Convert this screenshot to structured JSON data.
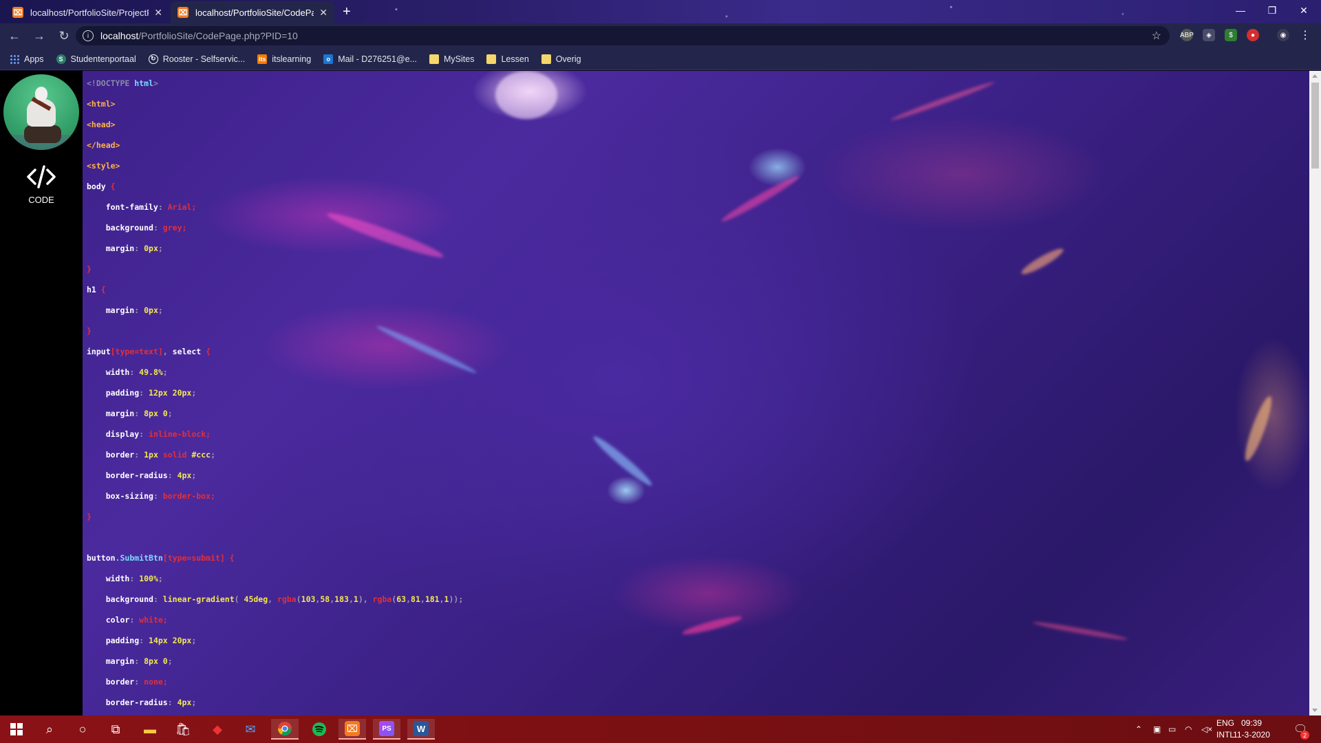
{
  "browser": {
    "tabs": [
      {
        "title": "localhost/PortfolioSite/ProjectPa",
        "active": false
      },
      {
        "title": "localhost/PortfolioSite/CodePage",
        "active": true
      }
    ],
    "new_tab_label": "+",
    "url_host": "localhost",
    "url_path": "/PortfolioSite/CodePage.php?PID=10",
    "bookmarks": [
      {
        "label": "Apps",
        "icon": "apps-grid-icon"
      },
      {
        "label": "Studentenportaal",
        "icon": "student-portal-icon"
      },
      {
        "label": "Rooster - Selfservic...",
        "icon": "rooster-icon"
      },
      {
        "label": "itslearning",
        "icon": "itslearning-icon"
      },
      {
        "label": "Mail - D276251@e...",
        "icon": "outlook-icon"
      },
      {
        "label": "MySites",
        "icon": "folder-icon"
      },
      {
        "label": "Lessen",
        "icon": "folder-icon"
      },
      {
        "label": "Overig",
        "icon": "folder-icon"
      }
    ]
  },
  "sidebar": {
    "nav_label": "CODE",
    "nav_icon": "code-brackets-icon"
  },
  "code_lines": [
    [
      {
        "t": "<!DOCTYPE ",
        "c": "c-doctype"
      },
      {
        "t": "html",
        "c": "c-class"
      },
      {
        "t": ">",
        "c": "c-doctype"
      }
    ],
    [
      {
        "t": "<html>",
        "c": "c-tag"
      }
    ],
    [
      {
        "t": "<head>",
        "c": "c-tag"
      }
    ],
    [
      {
        "t": "</head>",
        "c": "c-tag"
      }
    ],
    [
      {
        "t": "<style>",
        "c": "c-tag"
      }
    ],
    [
      {
        "t": "body ",
        "c": "c-sel"
      },
      {
        "t": "{",
        "c": "c-brace"
      }
    ],
    [
      {
        "t": "    font-family",
        "c": "c-prop"
      },
      {
        "t": ": ",
        "c": "c-punc"
      },
      {
        "t": "Arial",
        "c": "c-str"
      },
      {
        "t": ";",
        "c": "c-str"
      }
    ],
    [
      {
        "t": "    background",
        "c": "c-prop"
      },
      {
        "t": ": ",
        "c": "c-punc"
      },
      {
        "t": "grey",
        "c": "c-str"
      },
      {
        "t": ";",
        "c": "c-str"
      }
    ],
    [
      {
        "t": "    margin",
        "c": "c-prop"
      },
      {
        "t": ": ",
        "c": "c-punc"
      },
      {
        "t": "0px",
        "c": "c-num"
      },
      {
        "t": ";",
        "c": "c-punc"
      }
    ],
    [
      {
        "t": "}",
        "c": "c-brace"
      }
    ],
    [
      {
        "t": "h1 ",
        "c": "c-sel"
      },
      {
        "t": "{",
        "c": "c-brace"
      }
    ],
    [
      {
        "t": "    margin",
        "c": "c-prop"
      },
      {
        "t": ": ",
        "c": "c-punc"
      },
      {
        "t": "0px",
        "c": "c-num"
      },
      {
        "t": ";",
        "c": "c-punc"
      }
    ],
    [
      {
        "t": "}",
        "c": "c-brace"
      }
    ],
    [
      {
        "t": "input",
        "c": "c-sel"
      },
      {
        "t": "[type=text]",
        "c": "c-attr"
      },
      {
        "t": ", ",
        "c": "c-punc"
      },
      {
        "t": "select ",
        "c": "c-sel"
      },
      {
        "t": "{",
        "c": "c-brace"
      }
    ],
    [
      {
        "t": "    width",
        "c": "c-prop"
      },
      {
        "t": ": ",
        "c": "c-punc"
      },
      {
        "t": "49.8%",
        "c": "c-num"
      },
      {
        "t": ";",
        "c": "c-punc"
      }
    ],
    [
      {
        "t": "    padding",
        "c": "c-prop"
      },
      {
        "t": ": ",
        "c": "c-punc"
      },
      {
        "t": "12px 20px",
        "c": "c-num"
      },
      {
        "t": ";",
        "c": "c-punc"
      }
    ],
    [
      {
        "t": "    margin",
        "c": "c-prop"
      },
      {
        "t": ": ",
        "c": "c-punc"
      },
      {
        "t": "8px 0",
        "c": "c-num"
      },
      {
        "t": ";",
        "c": "c-punc"
      }
    ],
    [
      {
        "t": "    display",
        "c": "c-prop"
      },
      {
        "t": ": ",
        "c": "c-punc"
      },
      {
        "t": "inline-block",
        "c": "c-str"
      },
      {
        "t": ";",
        "c": "c-str"
      }
    ],
    [
      {
        "t": "    border",
        "c": "c-prop"
      },
      {
        "t": ": ",
        "c": "c-punc"
      },
      {
        "t": "1px ",
        "c": "c-num"
      },
      {
        "t": "solid ",
        "c": "c-str"
      },
      {
        "t": "#ccc",
        "c": "c-num"
      },
      {
        "t": ";",
        "c": "c-punc"
      }
    ],
    [
      {
        "t": "    border-radius",
        "c": "c-prop"
      },
      {
        "t": ": ",
        "c": "c-punc"
      },
      {
        "t": "4px",
        "c": "c-num"
      },
      {
        "t": ";",
        "c": "c-punc"
      }
    ],
    [
      {
        "t": "    box-sizing",
        "c": "c-prop"
      },
      {
        "t": ": ",
        "c": "c-punc"
      },
      {
        "t": "border-box",
        "c": "c-str"
      },
      {
        "t": ";",
        "c": "c-str"
      }
    ],
    [
      {
        "t": "}",
        "c": "c-brace"
      }
    ],
    [
      {
        "t": "",
        "c": "c-punc"
      }
    ],
    [
      {
        "t": "button",
        "c": "c-sel"
      },
      {
        "t": ".SubmitBtn",
        "c": "c-class"
      },
      {
        "t": "[type=submit]",
        "c": "c-attr"
      },
      {
        "t": " {",
        "c": "c-brace"
      }
    ],
    [
      {
        "t": "    width",
        "c": "c-prop"
      },
      {
        "t": ": ",
        "c": "c-punc"
      },
      {
        "t": "100%",
        "c": "c-num"
      },
      {
        "t": ";",
        "c": "c-punc"
      }
    ],
    [
      {
        "t": "    background",
        "c": "c-prop"
      },
      {
        "t": ": ",
        "c": "c-punc"
      },
      {
        "t": "linear-gradient",
        "c": "c-num"
      },
      {
        "t": "( ",
        "c": "c-punc"
      },
      {
        "t": "45deg",
        "c": "c-num"
      },
      {
        "t": ", ",
        "c": "c-punc"
      },
      {
        "t": "rgba",
        "c": "c-str"
      },
      {
        "t": "(",
        "c": "c-punc"
      },
      {
        "t": "103",
        "c": "c-num"
      },
      {
        "t": ",",
        "c": "c-punc"
      },
      {
        "t": "58",
        "c": "c-num"
      },
      {
        "t": ",",
        "c": "c-punc"
      },
      {
        "t": "183",
        "c": "c-num"
      },
      {
        "t": ",",
        "c": "c-punc"
      },
      {
        "t": "1",
        "c": "c-num"
      },
      {
        "t": "), ",
        "c": "c-punc"
      },
      {
        "t": "rgba",
        "c": "c-str"
      },
      {
        "t": "(",
        "c": "c-punc"
      },
      {
        "t": "63",
        "c": "c-num"
      },
      {
        "t": ",",
        "c": "c-punc"
      },
      {
        "t": "81",
        "c": "c-num"
      },
      {
        "t": ",",
        "c": "c-punc"
      },
      {
        "t": "181",
        "c": "c-num"
      },
      {
        "t": ",",
        "c": "c-punc"
      },
      {
        "t": "1",
        "c": "c-num"
      },
      {
        "t": "));",
        "c": "c-punc"
      }
    ],
    [
      {
        "t": "    color",
        "c": "c-prop"
      },
      {
        "t": ": ",
        "c": "c-punc"
      },
      {
        "t": "white",
        "c": "c-str"
      },
      {
        "t": ";",
        "c": "c-str"
      }
    ],
    [
      {
        "t": "    padding",
        "c": "c-prop"
      },
      {
        "t": ": ",
        "c": "c-punc"
      },
      {
        "t": "14px 20px",
        "c": "c-num"
      },
      {
        "t": ";",
        "c": "c-punc"
      }
    ],
    [
      {
        "t": "    margin",
        "c": "c-prop"
      },
      {
        "t": ": ",
        "c": "c-punc"
      },
      {
        "t": "8px 0",
        "c": "c-num"
      },
      {
        "t": ";",
        "c": "c-punc"
      }
    ],
    [
      {
        "t": "    border",
        "c": "c-prop"
      },
      {
        "t": ": ",
        "c": "c-punc"
      },
      {
        "t": "none",
        "c": "c-str"
      },
      {
        "t": ";",
        "c": "c-str"
      }
    ],
    [
      {
        "t": "    border-radius",
        "c": "c-prop"
      },
      {
        "t": ": ",
        "c": "c-punc"
      },
      {
        "t": "4px",
        "c": "c-num"
      },
      {
        "t": ";",
        "c": "c-punc"
      }
    ]
  ],
  "taskbar": {
    "apps": [
      "start-icon",
      "search-icon",
      "cortana-icon",
      "task-view-icon",
      "file-explorer-icon",
      "store-icon",
      "game-icon",
      "mail-icon",
      "chrome-icon",
      "spotify-icon",
      "xampp-icon",
      "phpstorm-icon",
      "word-icon"
    ],
    "language_line1": "ENG",
    "language_line2": "INTL",
    "time": "09:39",
    "date": "11-3-2020",
    "notification_count": "2"
  },
  "colors": {
    "taskbar": "#7a1012",
    "sidebar": "#000000",
    "chrome_toolbar": "#23264a"
  }
}
